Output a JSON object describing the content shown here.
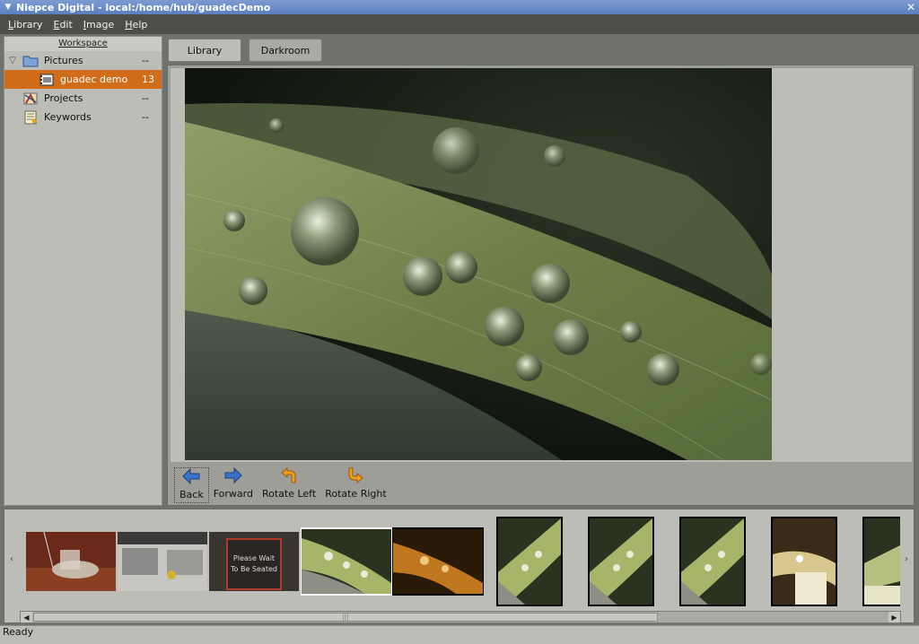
{
  "window": {
    "title": "Niepce Digital - local:/home/hub/guadecDemo"
  },
  "menubar": {
    "items": [
      {
        "mnemonic": "L",
        "rest": "ibrary"
      },
      {
        "mnemonic": "E",
        "rest": "dit"
      },
      {
        "mnemonic": "I",
        "rest": "mage"
      },
      {
        "mnemonic": "H",
        "rest": "elp"
      }
    ]
  },
  "workspace": {
    "title": "Workspace",
    "items": [
      {
        "label": "Pictures",
        "count": "--",
        "icon": "folder-icon"
      },
      {
        "label": "guadec demo",
        "count": "13",
        "icon": "film-roll-icon"
      },
      {
        "label": "Projects",
        "count": "--",
        "icon": "projects-icon"
      },
      {
        "label": "Keywords",
        "count": "--",
        "icon": "keywords-icon"
      }
    ]
  },
  "tabs": {
    "library": "Library",
    "darkroom": "Darkroom"
  },
  "toolbar": {
    "back": "Back",
    "forward": "Forward",
    "rotate_left": "Rotate Left",
    "rotate_right": "Rotate Right"
  },
  "colors": {
    "accent": "#d06c1a",
    "back_arrow": "#3a72c8",
    "rotate_arrow": "#f0a020"
  },
  "status": {
    "text": "Ready"
  }
}
